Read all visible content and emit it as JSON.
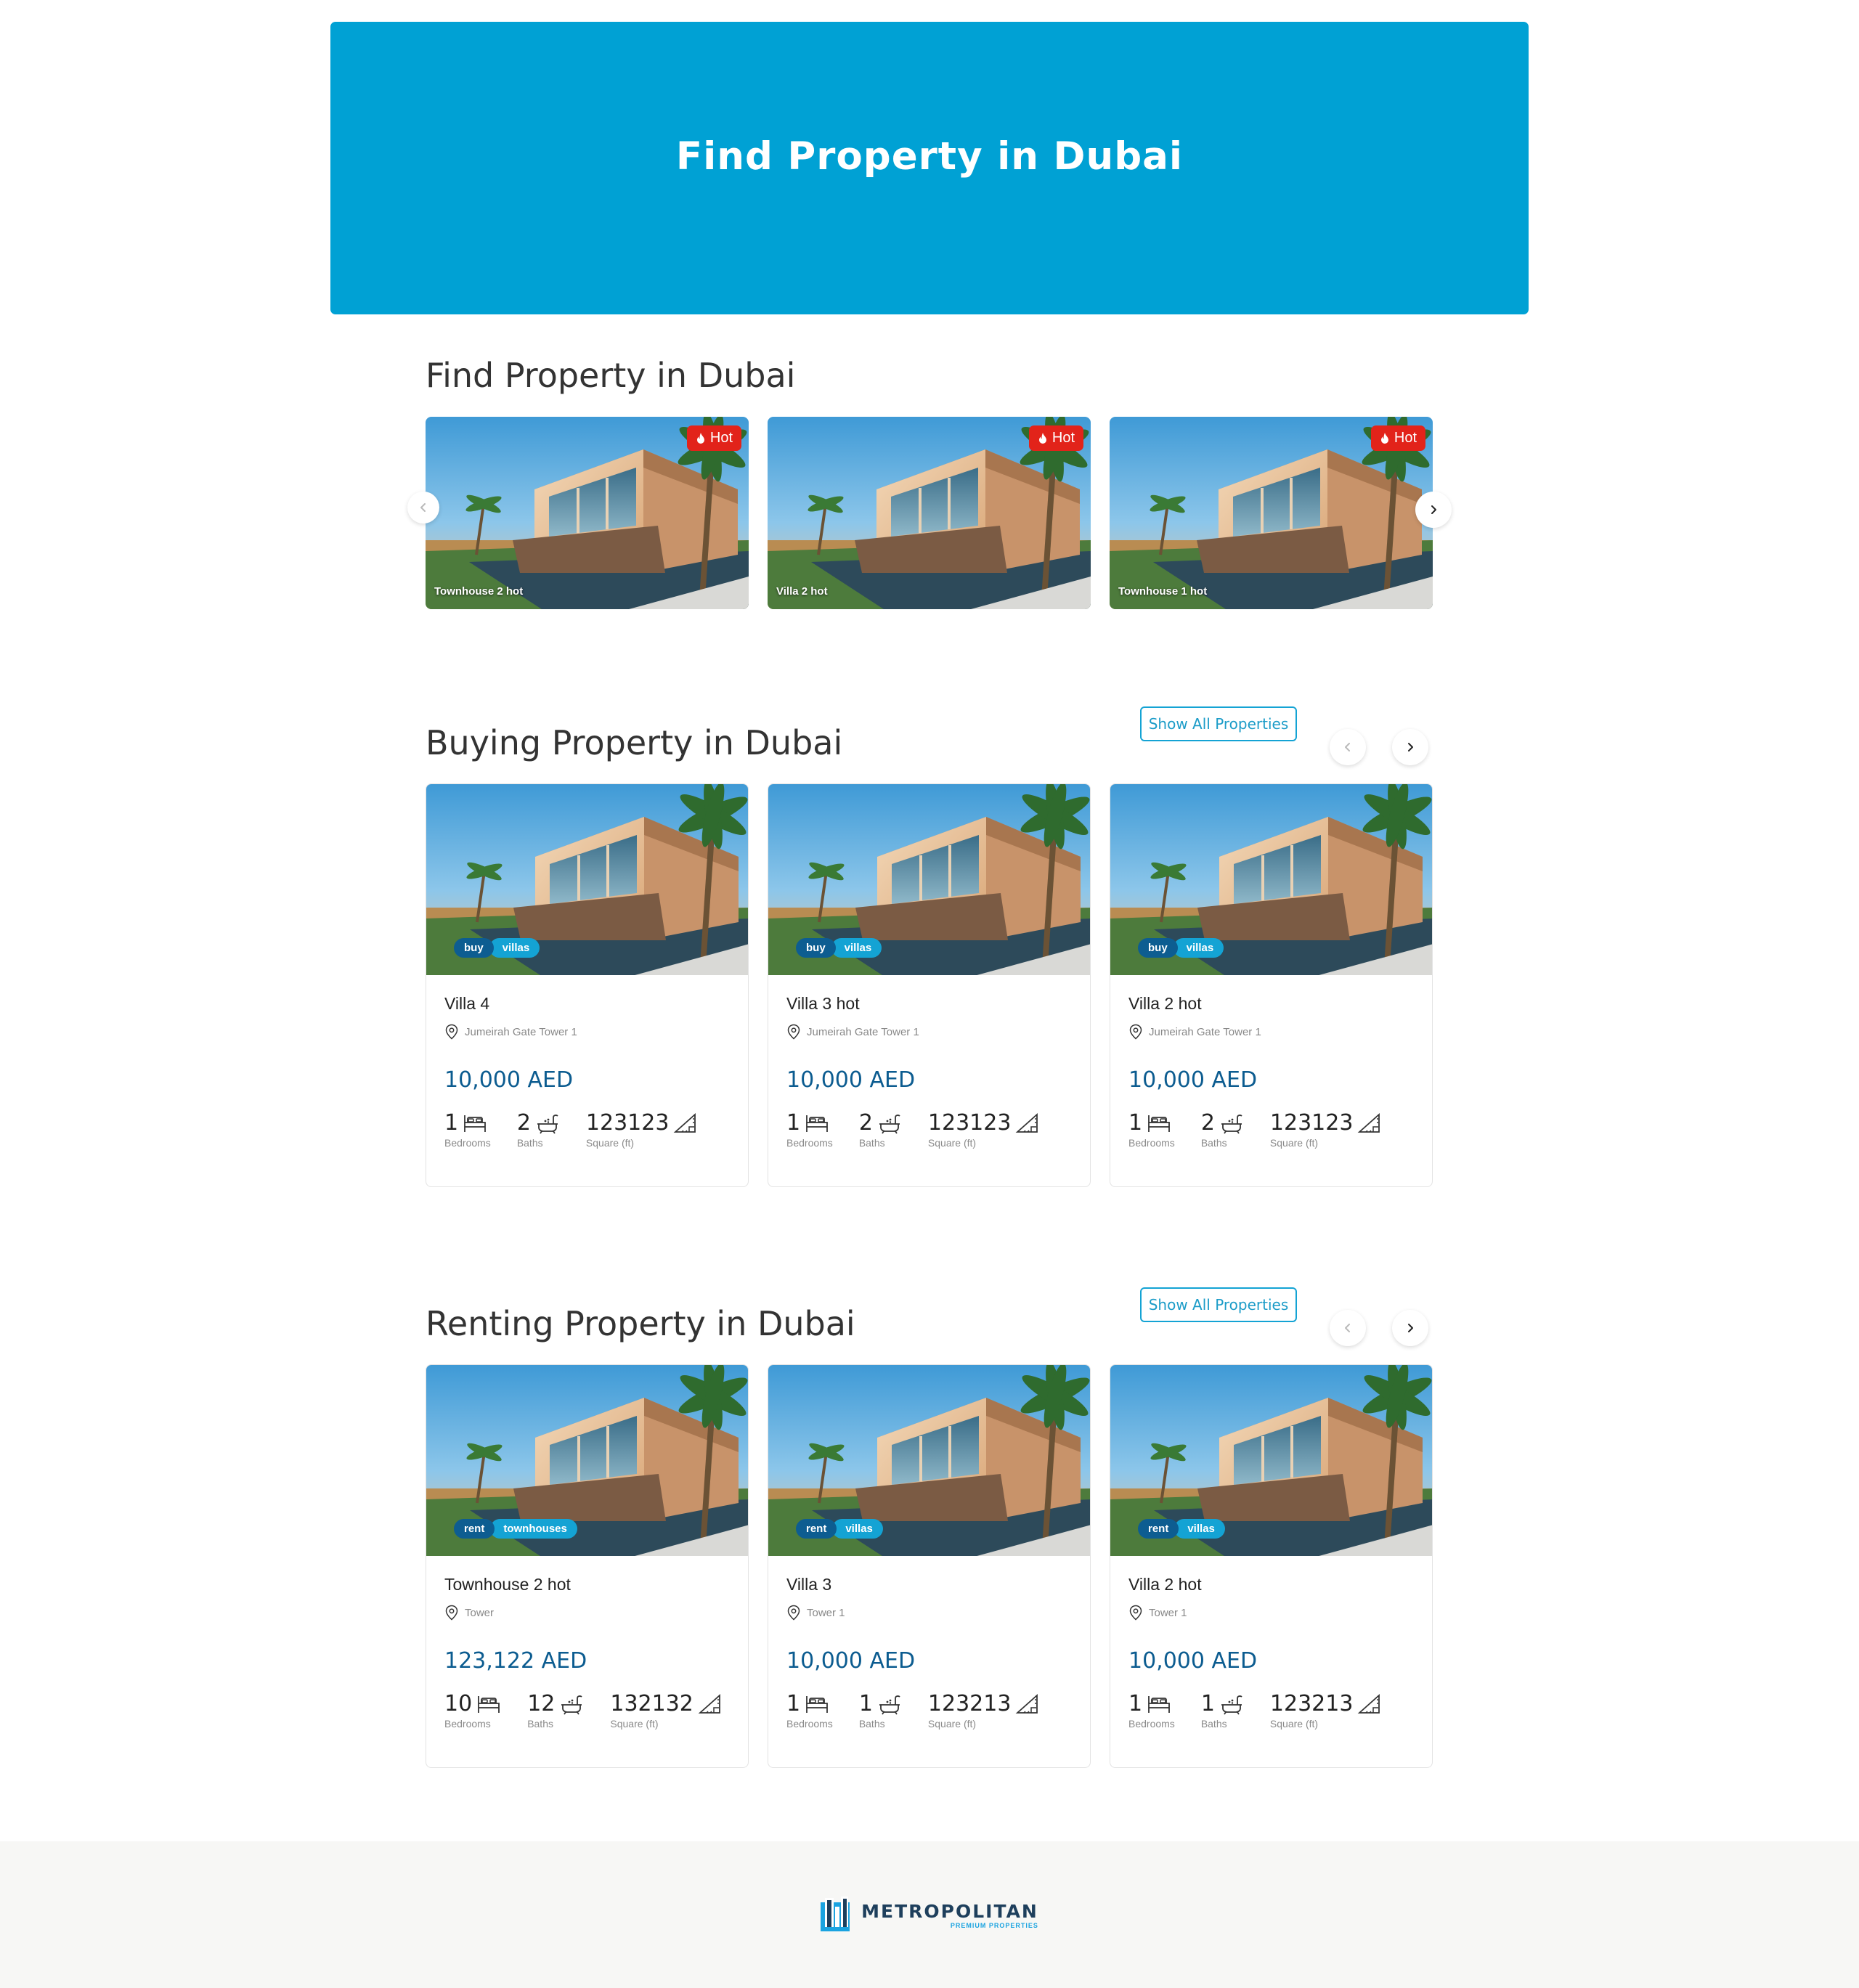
{
  "hero": {
    "title": "Find Property in Dubai"
  },
  "featured": {
    "title": "Find Property in Dubai",
    "items": [
      {
        "name": "Townhouse 2 hot",
        "badge": "Hot"
      },
      {
        "name": "Villa 2 hot",
        "badge": "Hot"
      },
      {
        "name": "Townhouse 1 hot",
        "badge": "Hot"
      }
    ]
  },
  "buying": {
    "title": "Buying Property in Dubai",
    "show_all": "Show All Properties",
    "cards": [
      {
        "tag1": "buy",
        "tag2": "villas",
        "title": "Villa 4",
        "location": "Jumeirah Gate Tower 1",
        "price": "10,000 AED",
        "bedrooms": "1",
        "baths": "2",
        "area": "123123"
      },
      {
        "tag1": "buy",
        "tag2": "villas",
        "title": "Villa 3 hot",
        "location": "Jumeirah Gate Tower 1",
        "price": "10,000 AED",
        "bedrooms": "1",
        "baths": "2",
        "area": "123123"
      },
      {
        "tag1": "buy",
        "tag2": "villas",
        "title": "Villa 2 hot",
        "location": "Jumeirah Gate Tower 1",
        "price": "10,000 AED",
        "bedrooms": "1",
        "baths": "2",
        "area": "123123"
      }
    ]
  },
  "renting": {
    "title": "Renting Property in Dubai",
    "show_all": "Show All Properties",
    "cards": [
      {
        "tag1": "rent",
        "tag2": "townhouses",
        "title": "Townhouse 2 hot",
        "location": "Tower",
        "price": "123,122 AED",
        "bedrooms": "10",
        "baths": "12",
        "area": "132132"
      },
      {
        "tag1": "rent",
        "tag2": "villas",
        "title": "Villa 3",
        "location": "Tower 1",
        "price": "10,000 AED",
        "bedrooms": "1",
        "baths": "1",
        "area": "123213"
      },
      {
        "tag1": "rent",
        "tag2": "villas",
        "title": "Villa 2 hot",
        "location": "Tower 1",
        "price": "10,000 AED",
        "bedrooms": "1",
        "baths": "1",
        "area": "123213"
      }
    ]
  },
  "labels": {
    "bedrooms": "Bedrooms",
    "baths": "Baths",
    "area": "Square (ft)"
  },
  "footer": {
    "brand": "METROPOLITAN",
    "tagline": "PREMIUM PROPERTIES"
  },
  "colors": {
    "hero": "#00a1d4",
    "price": "#0c5c90",
    "hot": "#e2231a",
    "tag_primary": "#0d5d91",
    "tag_secondary": "#14a3d4"
  }
}
